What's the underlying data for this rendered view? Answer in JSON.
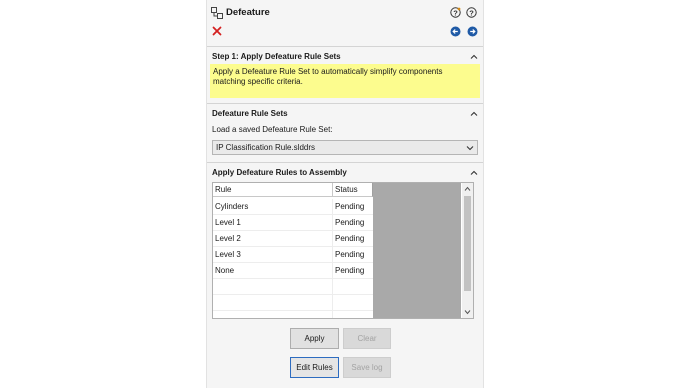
{
  "header": {
    "title": "Defeature",
    "icons": [
      "defeature-icon",
      "help-question-icon",
      "help-icon",
      "close-icon",
      "back-icon",
      "forward-icon"
    ]
  },
  "step1": {
    "title": "Step 1: Apply Defeature Rule Sets",
    "notice": "Apply a Defeature Rule Set to automatically simplify components matching specific criteria."
  },
  "rule_sets": {
    "title": "Defeature Rule Sets",
    "load_label": "Load a saved Defeature Rule Set:",
    "selected": "IP Classification Rule.slddrs"
  },
  "apply_rules": {
    "title": "Apply Defeature Rules to Assembly",
    "columns": [
      "Rule",
      "Status"
    ],
    "rows": [
      {
        "rule": "Cylinders",
        "status": "Pending"
      },
      {
        "rule": "Level 1",
        "status": "Pending"
      },
      {
        "rule": "Level 2",
        "status": "Pending"
      },
      {
        "rule": "Level 3",
        "status": "Pending"
      },
      {
        "rule": "None",
        "status": "Pending"
      }
    ]
  },
  "buttons": {
    "apply": "Apply",
    "clear": "Clear",
    "edit_rules": "Edit Rules",
    "save_log": "Save log"
  },
  "colors": {
    "notice_bg": "#fcfc8e",
    "close_red": "#d42020",
    "nav_blue": "#1f5aa6"
  }
}
